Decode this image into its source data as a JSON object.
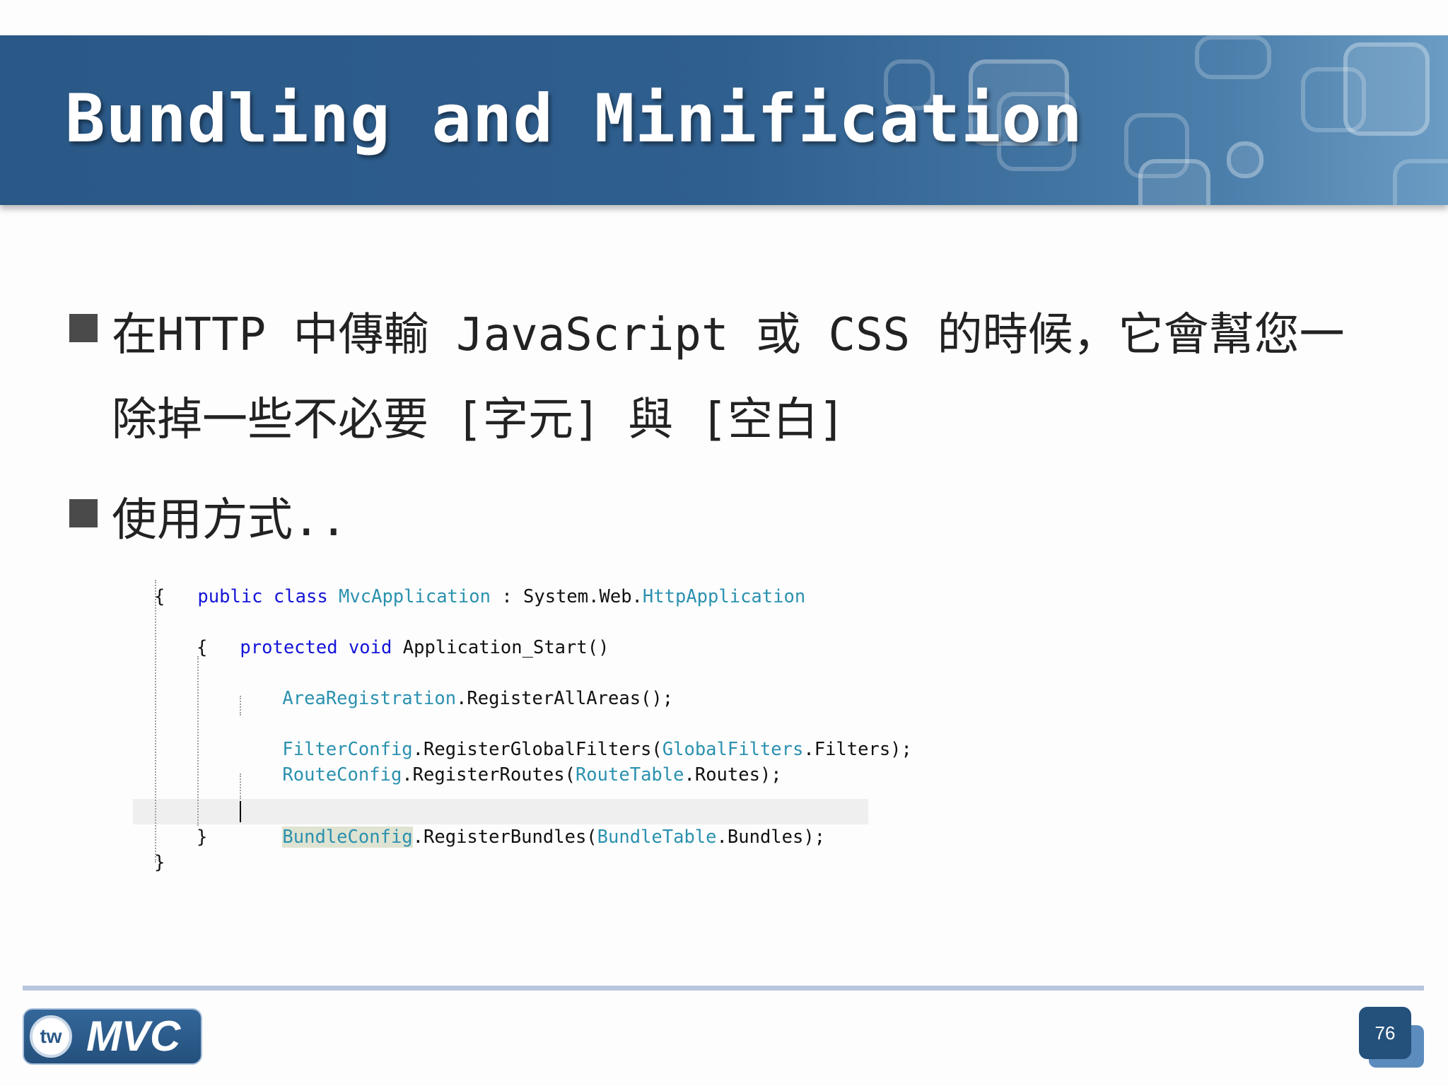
{
  "slide": {
    "title": "Bundling and Minification",
    "bullets": [
      {
        "line1": "在HTTP 中傳輸 JavaScript 或 CSS 的時候，它會幫您一",
        "line2": "除掉一些不必要 [字元] 與 [空白]"
      },
      {
        "line1": "使用方式.."
      }
    ],
    "page_number": "76"
  },
  "code": {
    "l1": {
      "kw1": "public",
      "kw2": "class",
      "cls": "MvcApplication",
      "sep": " : System.Web.",
      "base": "HttpApplication"
    },
    "l2": "{",
    "l3": {
      "kw1": "protected",
      "kw2": "void",
      "rest": "Application_Start()"
    },
    "l4": "{",
    "l5": {
      "t": "AreaRegistration",
      "rest": ".RegisterAllAreas();"
    },
    "l6": {
      "t1": "FilterConfig",
      "m": ".RegisterGlobalFilters(",
      "t2": "GlobalFilters",
      "rest": ".Filters);"
    },
    "l7": {
      "t1": "RouteConfig",
      "m": ".RegisterRoutes(",
      "t2": "RouteTable",
      "rest": ".Routes);"
    },
    "l8": {
      "t1": "BundleConfig",
      "m": ".RegisterBundles(",
      "t2": "BundleTable",
      "rest": ".Bundles);"
    },
    "l9": "}",
    "l10": "}"
  },
  "logo": {
    "badge": "tw",
    "name": "MVC"
  },
  "colors": {
    "banner": "#2a5887",
    "keyword": "#1414d8",
    "type": "#2b91af",
    "footer_line": "#b7c7dd"
  }
}
